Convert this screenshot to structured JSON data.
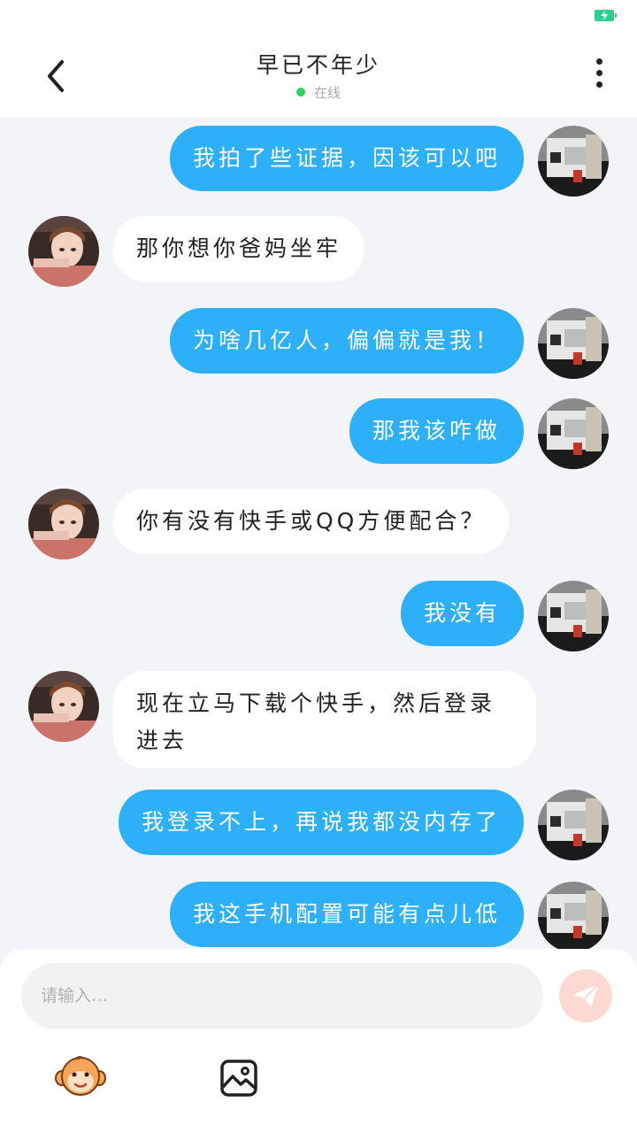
{
  "header": {
    "title": "早已不年少",
    "status": "在线"
  },
  "messages": [
    {
      "from": "me",
      "text": "我拍了些证据，因该可以吧"
    },
    {
      "from": "other",
      "text": "那你想你爸妈坐牢"
    },
    {
      "from": "me",
      "text": "为啥几亿人，偏偏就是我！"
    },
    {
      "from": "me",
      "text": "那我该咋做"
    },
    {
      "from": "other",
      "text": "你有没有快手或QQ方便配合？"
    },
    {
      "from": "me",
      "text": "我没有"
    },
    {
      "from": "other",
      "text": "现在立马下载个快手，然后登录进去"
    },
    {
      "from": "me",
      "text": "我登录不上，再说我都没内存了"
    },
    {
      "from": "me",
      "text": "我这手机配置可能有点儿低"
    }
  ],
  "input": {
    "placeholder": "请输入…",
    "value": ""
  },
  "icons": {
    "back": "chevron-left-icon",
    "more": "more-vertical-icon",
    "send": "paper-plane-icon",
    "emoji": "monkey-emoji-icon",
    "image": "image-icon",
    "battery": "battery-charging-icon"
  },
  "colors": {
    "my_bubble": "#2db0f7",
    "other_bubble": "#ffffff",
    "online_dot": "#2ecf5a",
    "send_button": "#fcd9d3",
    "background": "#f2f4f7"
  }
}
